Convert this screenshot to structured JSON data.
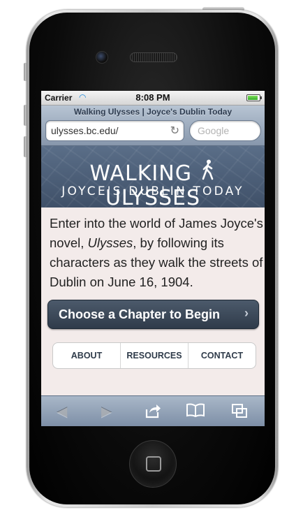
{
  "status_bar": {
    "carrier": "Carrier",
    "time": "8:08 PM",
    "battery_level": 0.9
  },
  "browser": {
    "page_title": "Walking Ulysses | Joyce's Dublin Today",
    "url": "ulysses.bc.edu/",
    "search_placeholder": "Google"
  },
  "banner": {
    "line1_left": "WALKING",
    "line1_right": "ULYSSES",
    "line2": "JOYCE'S DUBLIN TODAY"
  },
  "intro": {
    "before": "Enter into the world of James Joyce's novel, ",
    "emphasis": "Ulysses",
    "after": ", by following its characters as they walk the streets of Dublin on June 16, 1904."
  },
  "cta": {
    "label": "Choose a Chapter to Begin",
    "chevron": "›"
  },
  "nav": {
    "about": "ABOUT",
    "resources": "RESOURCES",
    "contact": "CONTACT"
  },
  "toolbar": {
    "back_icon": "◀",
    "forward_icon": "▶",
    "share_icon": "⇪",
    "bookmarks_icon": "🕮",
    "tabs_icon": "⧉"
  },
  "colors": {
    "banner": "#4a5c75",
    "cta": "#3a4656",
    "page_background": "#f3ebea"
  }
}
